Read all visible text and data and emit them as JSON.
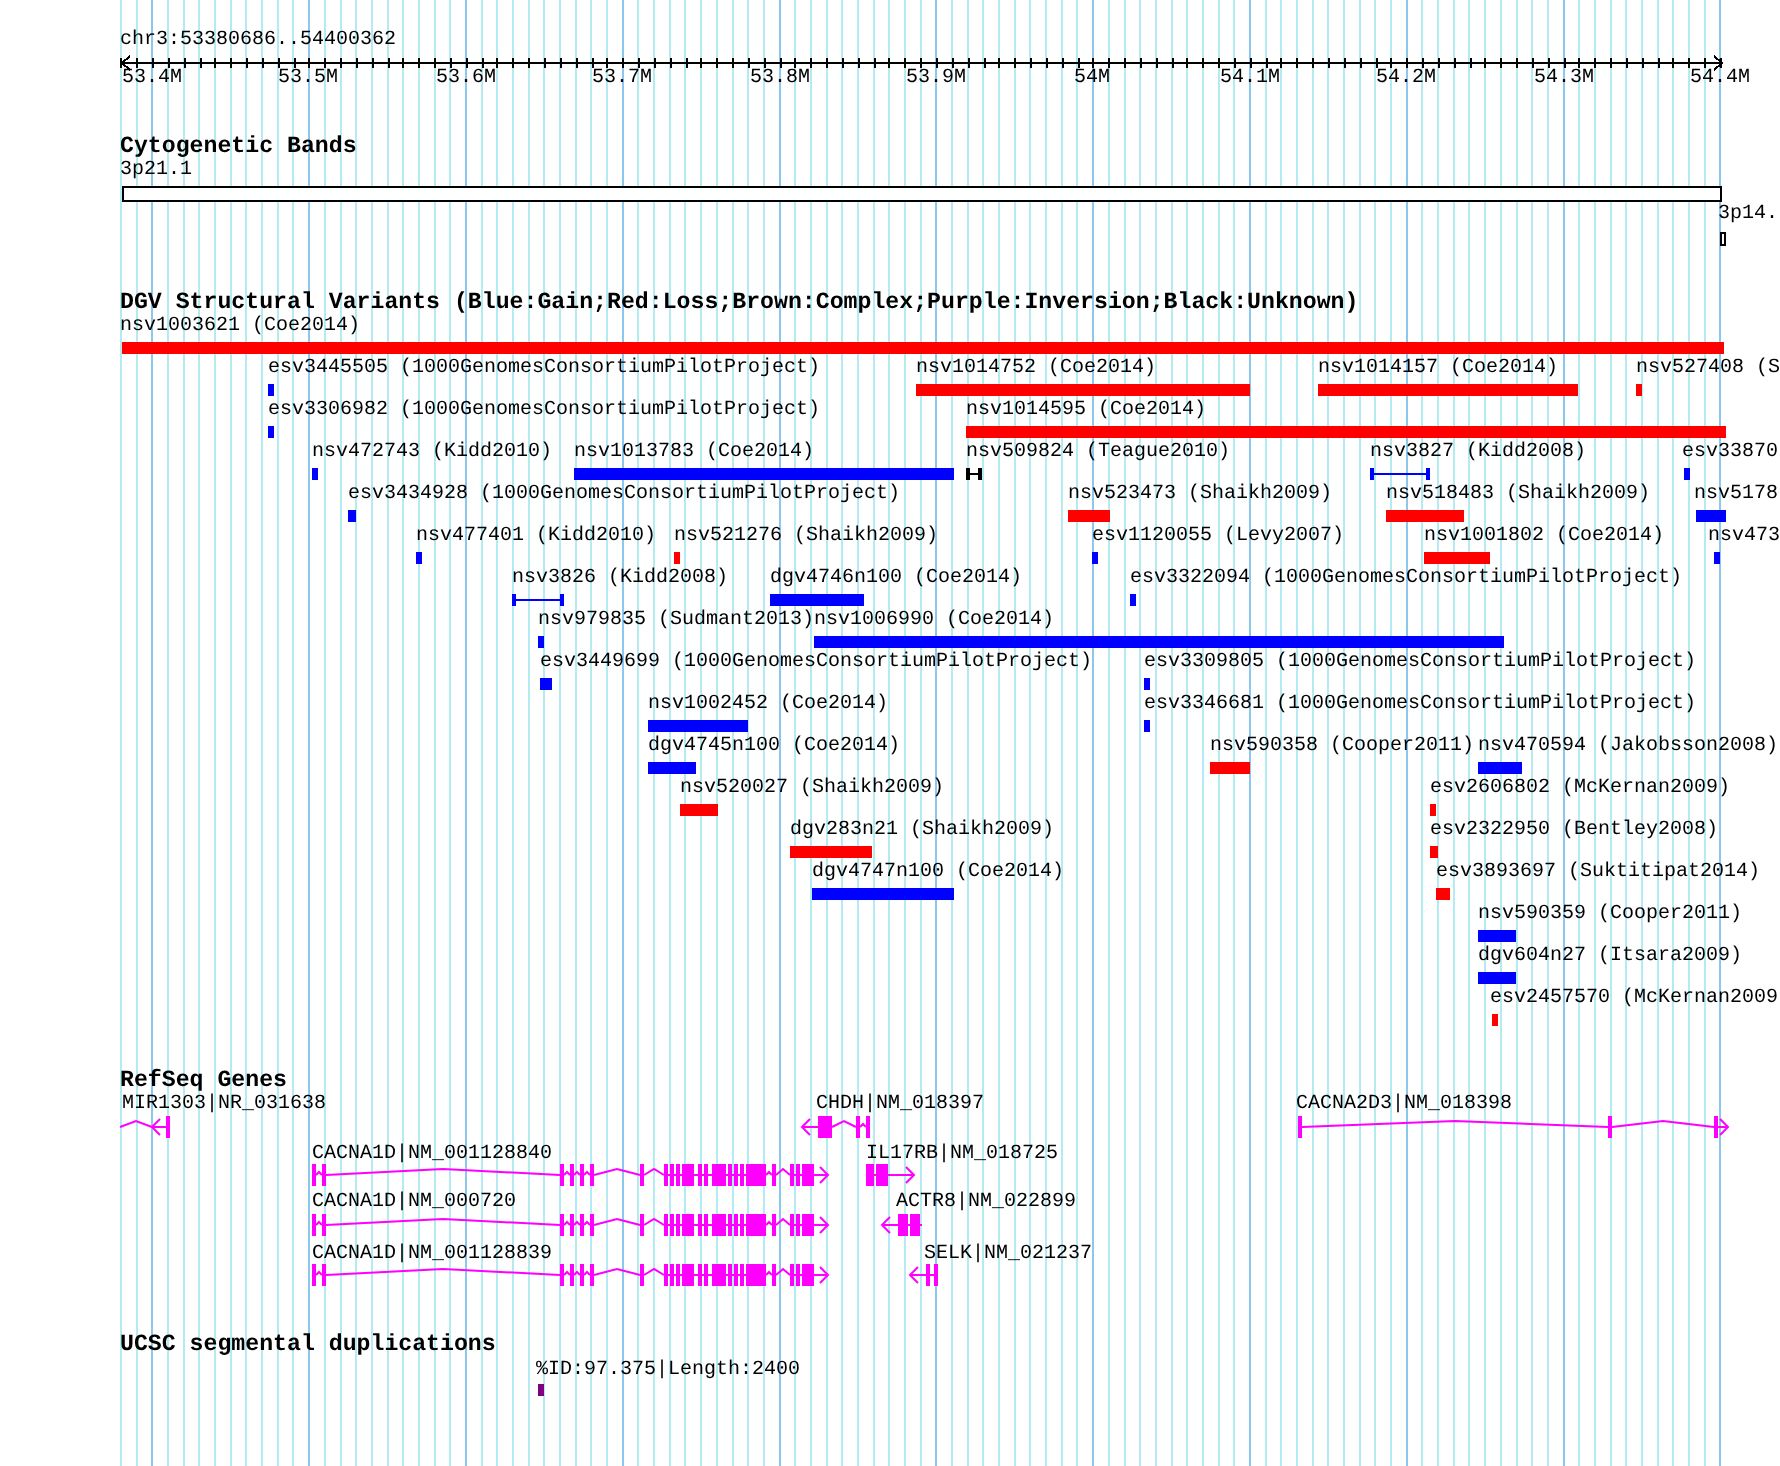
{
  "ruler": {
    "location": "chr3:53380686..54400362",
    "ticks": [
      "53.4M",
      "53.5M",
      "53.6M",
      "53.7M",
      "53.8M",
      "53.9M",
      "54M",
      "54.1M",
      "54.2M",
      "54.3M",
      "54.4M"
    ]
  },
  "cytogenetic_bands": {
    "title": "Cytogenetic Bands",
    "bands": [
      {
        "label": "3p21.1"
      },
      {
        "label": "3p14."
      }
    ]
  },
  "dgv_variants": {
    "title": "DGV Structural Variants (Blue:Gain;Red:Loss;Brown:Complex;Purple:Inversion;Black:Unknown)",
    "rows": [
      {
        "features": [
          {
            "label": "nsv1003621 (Coe2014)",
            "kind": "bar",
            "color": "#ff0000"
          }
        ]
      },
      {
        "features": [
          {
            "label": "esv3445505 (1000GenomesConsortiumPilotProject)",
            "kind": "bar",
            "color": "#0000ff"
          },
          {
            "label": "nsv1014752 (Coe2014)",
            "kind": "bar",
            "color": "#ff0000"
          },
          {
            "label": "nsv1014157 (Coe2014)",
            "kind": "bar",
            "color": "#ff0000"
          },
          {
            "label": "nsv527408 (S",
            "kind": "bar",
            "color": "#ff0000"
          }
        ]
      },
      {
        "features": [
          {
            "label": "esv3306982 (1000GenomesConsortiumPilotProject)",
            "kind": "bar",
            "color": "#0000ff"
          },
          {
            "label": "nsv1014595 (Coe2014)",
            "kind": "bar",
            "color": "#ff0000"
          }
        ]
      },
      {
        "features": [
          {
            "label": "nsv472743 (Kidd2010)",
            "kind": "bar",
            "color": "#0000ff"
          },
          {
            "label": "nsv1013783 (Coe2014)",
            "kind": "bar",
            "color": "#0000ff"
          },
          {
            "label": "nsv509824 (Teague2010)",
            "kind": "span",
            "color": "#000000"
          },
          {
            "label": "nsv3827 (Kidd2008)",
            "kind": "span",
            "color": "#0000ff"
          },
          {
            "label": "esv33870",
            "kind": "bar",
            "color": "#0000ff"
          }
        ]
      },
      {
        "features": [
          {
            "label": "esv3434928 (1000GenomesConsortiumPilotProject)",
            "kind": "bar",
            "color": "#0000ff"
          },
          {
            "label": "nsv523473 (Shaikh2009)",
            "kind": "bar",
            "color": "#ff0000"
          },
          {
            "label": "nsv518483 (Shaikh2009)",
            "kind": "bar",
            "color": "#ff0000"
          },
          {
            "label": "nsv5178",
            "kind": "bar",
            "color": "#0000ff"
          }
        ]
      },
      {
        "features": [
          {
            "label": "nsv477401 (Kidd2010)",
            "kind": "bar",
            "color": "#0000ff"
          },
          {
            "label": "nsv521276 (Shaikh2009)",
            "kind": "bar",
            "color": "#ff0000"
          },
          {
            "label": "esv1120055 (Levy2007)",
            "kind": "bar",
            "color": "#0000ff"
          },
          {
            "label": "nsv1001802 (Coe2014)",
            "kind": "bar",
            "color": "#ff0000"
          },
          {
            "label": "nsv473",
            "kind": "bar",
            "color": "#0000ff"
          }
        ]
      },
      {
        "features": [
          {
            "label": "nsv3826 (Kidd2008)",
            "kind": "span",
            "color": "#0000ff"
          },
          {
            "label": "dgv4746n100 (Coe2014)",
            "kind": "bar",
            "color": "#0000ff"
          },
          {
            "label": "esv3322094 (1000GenomesConsortiumPilotProject)",
            "kind": "bar",
            "color": "#0000ff"
          }
        ]
      },
      {
        "features": [
          {
            "label": "nsv979835 (Sudmant2013)",
            "kind": "bar",
            "color": "#0000ff"
          },
          {
            "label": "nsv1006990 (Coe2014)",
            "kind": "bar",
            "color": "#0000ff"
          }
        ]
      },
      {
        "features": [
          {
            "label": "esv3449699 (1000GenomesConsortiumPilotProject)",
            "kind": "bar",
            "color": "#0000ff"
          },
          {
            "label": "esv3309805 (1000GenomesConsortiumPilotProject)",
            "kind": "bar",
            "color": "#0000ff"
          }
        ]
      },
      {
        "features": [
          {
            "label": "nsv1002452 (Coe2014)",
            "kind": "bar",
            "color": "#0000ff"
          },
          {
            "label": "esv3346681 (1000GenomesConsortiumPilotProject)",
            "kind": "bar",
            "color": "#0000ff"
          }
        ]
      },
      {
        "features": [
          {
            "label": "dgv4745n100 (Coe2014)",
            "kind": "bar",
            "color": "#0000ff"
          },
          {
            "label": "nsv590358 (Cooper2011)",
            "kind": "bar",
            "color": "#ff0000"
          },
          {
            "label": "nsv470594 (Jakobsson2008)",
            "kind": "bar",
            "color": "#0000ff"
          }
        ]
      },
      {
        "features": [
          {
            "label": "nsv520027 (Shaikh2009)",
            "kind": "bar",
            "color": "#ff0000"
          },
          {
            "label": "esv2606802 (McKernan2009)",
            "kind": "bar",
            "color": "#ff0000"
          }
        ]
      },
      {
        "features": [
          {
            "label": "dgv283n21 (Shaikh2009)",
            "kind": "bar",
            "color": "#ff0000"
          },
          {
            "label": "esv2322950 (Bentley2008)",
            "kind": "bar",
            "color": "#ff0000"
          }
        ]
      },
      {
        "features": [
          {
            "label": "dgv4747n100 (Coe2014)",
            "kind": "bar",
            "color": "#0000ff"
          },
          {
            "label": "esv3893697 (Suktitipat2014)",
            "kind": "bar",
            "color": "#ff0000"
          }
        ]
      },
      {
        "features": [
          {
            "label": "nsv590359 (Cooper2011)",
            "kind": "bar",
            "color": "#0000ff"
          }
        ]
      },
      {
        "features": [
          {
            "label": "dgv604n27 (Itsara2009)",
            "kind": "bar",
            "color": "#0000ff"
          }
        ]
      },
      {
        "features": [
          {
            "label": "esv2457570 (McKernan2009",
            "kind": "bar",
            "color": "#ff0000"
          }
        ]
      }
    ]
  },
  "refseq_genes": {
    "title": "RefSeq Genes",
    "genes": [
      {
        "label": "MIR1303|NR_031638",
        "reverse_strand": true
      },
      {
        "label": "CHDH|NM_018397",
        "reverse_strand": true
      },
      {
        "label": "CACNA2D3|NM_018398",
        "reverse_strand": false
      },
      {
        "label": "CACNA1D|NM_001128840",
        "reverse_strand": false
      },
      {
        "label": "IL17RB|NM_018725",
        "reverse_strand": false
      },
      {
        "label": "CACNA1D|NM_000720",
        "reverse_strand": false
      },
      {
        "label": "ACTR8|NM_022899",
        "reverse_strand": true
      },
      {
        "label": "CACNA1D|NM_001128839",
        "reverse_strand": false
      },
      {
        "label": "SELK|NM_021237",
        "reverse_strand": true
      }
    ]
  },
  "segmental_duplications": {
    "title": "UCSC segmental duplications",
    "features": [
      {
        "label": "%ID:97.375|Length:2400"
      }
    ]
  }
}
